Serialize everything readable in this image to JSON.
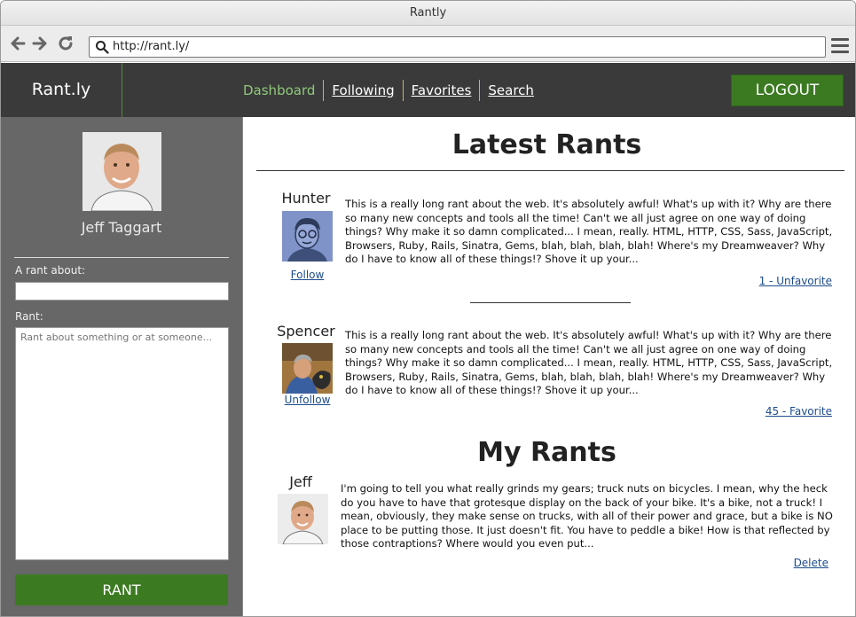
{
  "window": {
    "title": "Rantly"
  },
  "browser": {
    "back_icon": "arrow-left-icon",
    "forward_icon": "arrow-right-icon",
    "reload_icon": "reload-icon",
    "url": "http://rant.ly/",
    "menu_icon": "hamburger-menu-icon"
  },
  "header": {
    "brand": "Rant.ly",
    "nav": [
      "Dashboard",
      "Following",
      "Favorites",
      "Search"
    ],
    "logout_label": "LOGOUT"
  },
  "sidebar": {
    "user_name": "Jeff Taggart",
    "rant_about_label": "A rant about:",
    "rant_about_value": "",
    "rant_label": "Rant:",
    "rant_placeholder": "Rant about something or at someone...",
    "submit_label": "RANT"
  },
  "latest": {
    "title": "Latest Rants",
    "rants": [
      {
        "author": "Hunter",
        "follow_label": "Follow",
        "body": "This is a really long rant about the web. It's absolutely awful! What's up with it? Why are there so many new concepts and tools all the time! Can't we all just agree on one way of doing things? Why make it so damn complicated... I mean, really. HTML, HTTP, CSS, Sass, JavaScript, Browsers, Ruby, Rails, Sinatra, Gems, blah, blah, blah, blah! Where's my Dreamweaver? Why do I have to know all of these things!? Shove it up your...",
        "action": "1 - Unfavorite"
      },
      {
        "author": "Spencer",
        "follow_label": "Unfollow",
        "body": "This is a really long rant about the web. It's absolutely awful! What's up with it? Why are there so many new concepts and tools all the time! Can't we all just agree on one way of doing things? Why make it so damn complicated... I mean, really. HTML, HTTP, CSS, Sass, JavaScript, Browsers, Ruby, Rails, Sinatra, Gems, blah, blah, blah, blah! Where's my Dreamweaver? Why do I have to know all of these things!? Shove it up your...",
        "action": "45 - Favorite"
      }
    ]
  },
  "mine": {
    "title": "My Rants",
    "rants": [
      {
        "author": "Jeff",
        "body": "I'm going to tell you what really grinds my gears; truck nuts on bicycles. I mean, why the heck do you have to have that grotesque display on the back of your bike. It's a bike, not a truck! I mean, obviously, they make sense on trucks, with all of their power and grace, but a bike is NO place to be putting those. It just doesn't fit. You have to peddle a bike! How is that reflected by those contraptions? Where would you even put...",
        "action": "Delete"
      }
    ]
  }
}
